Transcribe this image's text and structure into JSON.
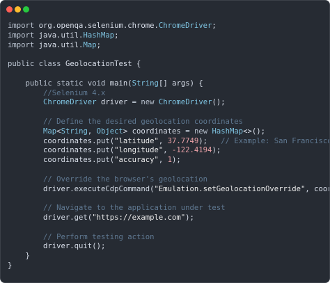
{
  "window": {
    "controls": [
      "close",
      "minimize",
      "maximize"
    ]
  },
  "colors": {
    "background": "#262b33",
    "keyword": "#b9c2cf",
    "comment": "#5f7891",
    "type": "#7ec3e0",
    "number": "#e8a0a6"
  },
  "code": {
    "language": "Java",
    "lines": [
      [
        {
          "t": "kw",
          "v": "import"
        },
        {
          "t": "pl",
          "v": " org.openqa.selenium.chrome."
        },
        {
          "t": "ty",
          "v": "ChromeDriver"
        },
        {
          "t": "pl",
          "v": ";"
        }
      ],
      [
        {
          "t": "kw",
          "v": "import"
        },
        {
          "t": "pl",
          "v": " java.util."
        },
        {
          "t": "ty",
          "v": "HashMap"
        },
        {
          "t": "pl",
          "v": ";"
        }
      ],
      [
        {
          "t": "kw",
          "v": "import"
        },
        {
          "t": "pl",
          "v": " java.util."
        },
        {
          "t": "ty",
          "v": "Map"
        },
        {
          "t": "pl",
          "v": ";"
        }
      ],
      [],
      [
        {
          "t": "kw",
          "v": "public"
        },
        {
          "t": "pl",
          "v": " "
        },
        {
          "t": "kw",
          "v": "class"
        },
        {
          "t": "pl",
          "v": " GeolocationTest {"
        }
      ],
      [],
      [
        {
          "t": "pl",
          "v": "    "
        },
        {
          "t": "kw",
          "v": "public"
        },
        {
          "t": "pl",
          "v": " "
        },
        {
          "t": "kw",
          "v": "static"
        },
        {
          "t": "pl",
          "v": " "
        },
        {
          "t": "kw",
          "v": "void"
        },
        {
          "t": "pl",
          "v": " main("
        },
        {
          "t": "ty",
          "v": "String"
        },
        {
          "t": "pl",
          "v": "[] args) {"
        }
      ],
      [
        {
          "t": "pl",
          "v": "        "
        },
        {
          "t": "cm",
          "v": "//Selenium 4.x"
        }
      ],
      [
        {
          "t": "pl",
          "v": "        "
        },
        {
          "t": "ty",
          "v": "ChromeDriver"
        },
        {
          "t": "pl",
          "v": " driver "
        },
        {
          "t": "op",
          "v": "="
        },
        {
          "t": "pl",
          "v": " "
        },
        {
          "t": "kw",
          "v": "new"
        },
        {
          "t": "pl",
          "v": " "
        },
        {
          "t": "ty",
          "v": "ChromeDriver"
        },
        {
          "t": "pl",
          "v": "();"
        }
      ],
      [],
      [
        {
          "t": "pl",
          "v": "        "
        },
        {
          "t": "cm",
          "v": "// Define the desired geolocation coordinates"
        }
      ],
      [
        {
          "t": "pl",
          "v": "        "
        },
        {
          "t": "ty",
          "v": "Map"
        },
        {
          "t": "pl",
          "v": "<"
        },
        {
          "t": "ty",
          "v": "String"
        },
        {
          "t": "pl",
          "v": ", "
        },
        {
          "t": "ty",
          "v": "Object"
        },
        {
          "t": "pl",
          "v": "> coordinates "
        },
        {
          "t": "op",
          "v": "="
        },
        {
          "t": "pl",
          "v": " "
        },
        {
          "t": "kw",
          "v": "new"
        },
        {
          "t": "pl",
          "v": " "
        },
        {
          "t": "ty",
          "v": "HashMap"
        },
        {
          "t": "pl",
          "v": "<>();"
        }
      ],
      [
        {
          "t": "pl",
          "v": "        coordinates."
        },
        {
          "t": "fn",
          "v": "put"
        },
        {
          "t": "pl",
          "v": "("
        },
        {
          "t": "str",
          "v": "\"latitude\""
        },
        {
          "t": "pl",
          "v": ", "
        },
        {
          "t": "num",
          "v": "37.7749"
        },
        {
          "t": "pl",
          "v": ");   "
        },
        {
          "t": "cm",
          "v": "// Example: San Francisco"
        }
      ],
      [
        {
          "t": "pl",
          "v": "        coordinates."
        },
        {
          "t": "fn",
          "v": "put"
        },
        {
          "t": "pl",
          "v": "("
        },
        {
          "t": "str",
          "v": "\"longitude\""
        },
        {
          "t": "pl",
          "v": ", "
        },
        {
          "t": "num",
          "v": "-122.4194"
        },
        {
          "t": "pl",
          "v": ");"
        }
      ],
      [
        {
          "t": "pl",
          "v": "        coordinates."
        },
        {
          "t": "fn",
          "v": "put"
        },
        {
          "t": "pl",
          "v": "("
        },
        {
          "t": "str",
          "v": "\"accuracy\""
        },
        {
          "t": "pl",
          "v": ", "
        },
        {
          "t": "num",
          "v": "1"
        },
        {
          "t": "pl",
          "v": ");"
        }
      ],
      [],
      [
        {
          "t": "pl",
          "v": "        "
        },
        {
          "t": "cm",
          "v": "// Override the browser's geolocation"
        }
      ],
      [
        {
          "t": "pl",
          "v": "        driver."
        },
        {
          "t": "fn",
          "v": "executeCdpCommand"
        },
        {
          "t": "pl",
          "v": "("
        },
        {
          "t": "str",
          "v": "\"Emulation.setGeolocationOverride\""
        },
        {
          "t": "pl",
          "v": ", coordinates);"
        }
      ],
      [],
      [
        {
          "t": "pl",
          "v": "        "
        },
        {
          "t": "cm",
          "v": "// Navigate to the application under test"
        }
      ],
      [
        {
          "t": "pl",
          "v": "        driver."
        },
        {
          "t": "fn",
          "v": "get"
        },
        {
          "t": "pl",
          "v": "("
        },
        {
          "t": "str",
          "v": "\"https://example.com\""
        },
        {
          "t": "pl",
          "v": ");"
        }
      ],
      [],
      [
        {
          "t": "pl",
          "v": "        "
        },
        {
          "t": "cm",
          "v": "// Perform testing action"
        }
      ],
      [
        {
          "t": "pl",
          "v": "        driver."
        },
        {
          "t": "fn",
          "v": "quit"
        },
        {
          "t": "pl",
          "v": "();"
        }
      ],
      [
        {
          "t": "pl",
          "v": "    }"
        }
      ],
      [
        {
          "t": "pl",
          "v": "}"
        }
      ]
    ]
  }
}
